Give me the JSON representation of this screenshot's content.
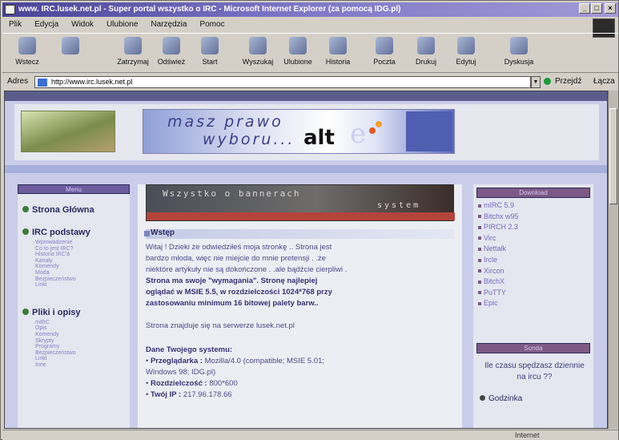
{
  "window": {
    "title": "www. IRC.lusek.net.pl - Super portal wszystko o IRC - Microsoft Internet Explorer (za pomocą IDG.pl)",
    "controls": [
      "_",
      "□",
      "×"
    ]
  },
  "menu": [
    "Plik",
    "Edycja",
    "Widok",
    "Ulubione",
    "Narzędzia",
    "Pomoc"
  ],
  "toolbar": [
    {
      "label": "Wstecz",
      "icon": "back-icon"
    },
    {
      "label": "",
      "icon": "forward-icon"
    },
    {
      "label": "Zatrzymaj",
      "icon": "stop-icon"
    },
    {
      "label": "Odśwież",
      "icon": "refresh-icon"
    },
    {
      "label": "Start",
      "icon": "home-icon"
    },
    {
      "label": "Wyszukaj",
      "icon": "search-icon"
    },
    {
      "label": "Ulubione",
      "icon": "favorites-icon"
    },
    {
      "label": "Historia",
      "icon": "history-icon"
    },
    {
      "label": "Poczta",
      "icon": "mail-icon"
    },
    {
      "label": "Drukuj",
      "icon": "print-icon"
    },
    {
      "label": "Edytuj",
      "icon": "edit-icon"
    },
    {
      "label": "Dyskusja",
      "icon": "discuss-icon"
    }
  ],
  "address": {
    "label": "Adres",
    "url": "http://www.irc.lusek.net.pl",
    "go_label": "Przejdź",
    "links_label": "Łącza"
  },
  "status": {
    "zone": "Internet"
  },
  "page": {
    "banner": {
      "line1": "masz prawo",
      "line2": "wyboru...",
      "brand": "alt"
    },
    "left_menu": {
      "header": "Menu",
      "home": "Strona Główna",
      "section1": "IRC podstawy",
      "section1_items": [
        "Wprowadzenie",
        "Co to jest IRC?",
        "Historia IRC'a",
        "Kanały",
        "Komendy",
        "Moda",
        "Bezpieczeństwo",
        "Linki"
      ],
      "section2": "Pliki i opisy",
      "section2_items": [
        "mIRC",
        "Opis",
        "Komendy",
        "Skrypty",
        "Programy",
        "Bezpieczeństwo",
        "Linki",
        "Inne"
      ]
    },
    "center": {
      "banner_text": "Wszystko o bannerach",
      "banner_sub": "system",
      "heading": "Wstęp",
      "lines": [
        "Witaj ! Dzieki że odwiedziłeś moja stronkę .. Strona jest",
        "bardzo młoda, więc nie miejcie do mnie pretensji . .że",
        "niektóre artykuły nie są dokończone . .ale bądźcie cierpliwi ."
      ],
      "bold_lines": [
        "Strona ma swoje \"wymagania\". Stronę najlepiej",
        "oglądać w MSIE 5.5, w rozdzielczości 1024*768 przy",
        "zastosowaniu minimum 16 bitowej palety barw.."
      ],
      "server_note": "Strona znajduje się na serwerze lusek.net.pl",
      "system_title": "Dane Twojego systemu:",
      "system": {
        "browser_label": "Przeglądarka :",
        "browser_value": "Mozilla/4.0 (compatible; MSIE 5.01;",
        "browser_value2": "Windows 98; IDG.pl)",
        "res_label": "Rozdzielczość :",
        "res_value": "800*600",
        "ip_label": "Twój IP :",
        "ip_value": "217.96.178.66"
      }
    },
    "right": {
      "download_header": "Download",
      "downloads": [
        "mIRC 5.9",
        "Bitchx w95",
        "PIRCH 2.3",
        "Virc",
        "Nettalk",
        "Ircle",
        "Xircon",
        "BitchX",
        "PuTTY",
        "Epic"
      ],
      "survey_header": "Sonda",
      "survey_question": "Ile czasu spędzasz dziennie na ircu ??",
      "clock_label": "Godzinka"
    }
  }
}
